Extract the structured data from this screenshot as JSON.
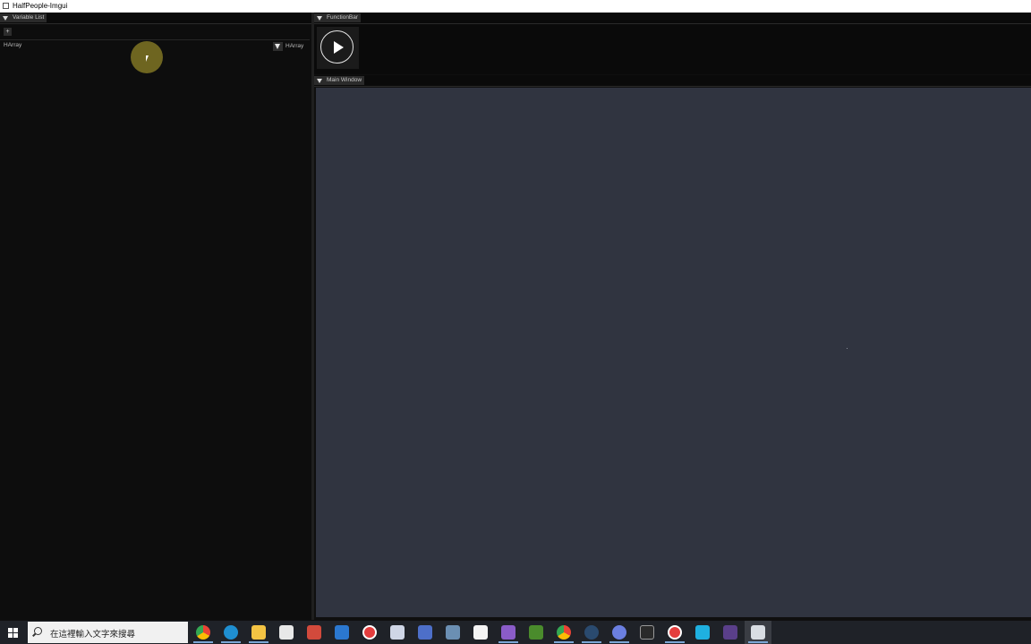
{
  "window": {
    "title": "HalfPeople-Imgui"
  },
  "left_panel": {
    "tab_label": "Variable List",
    "add_button_label": "+",
    "item_label": "HArray",
    "combo_value": "HArray"
  },
  "function_bar": {
    "tab_label": "FunctionBar",
    "play_button": "play-icon"
  },
  "main_window": {
    "tab_label": "Main Window"
  },
  "taskbar": {
    "search_placeholder": "在這裡輸入文字來搜尋",
    "icons": [
      "chrome-icon",
      "edge-icon",
      "file-explorer-icon",
      "store-icon",
      "app-icon",
      "mail-icon",
      "record-icon",
      "cloud-icon",
      "app-icon",
      "calculator-icon",
      "notepad-icon",
      "visual-studio-icon",
      "minecraft-icon",
      "chrome-icon",
      "steam-icon",
      "discord-icon",
      "epic-games-icon",
      "record-icon",
      "vpn-icon",
      "terminal-icon",
      "imgui-app-icon"
    ]
  },
  "colors": {
    "panel_bg": "#0d0d0d",
    "main_canvas": "#303440",
    "tab_bg": "#2b2b2b",
    "taskbar": "#1f2228"
  }
}
